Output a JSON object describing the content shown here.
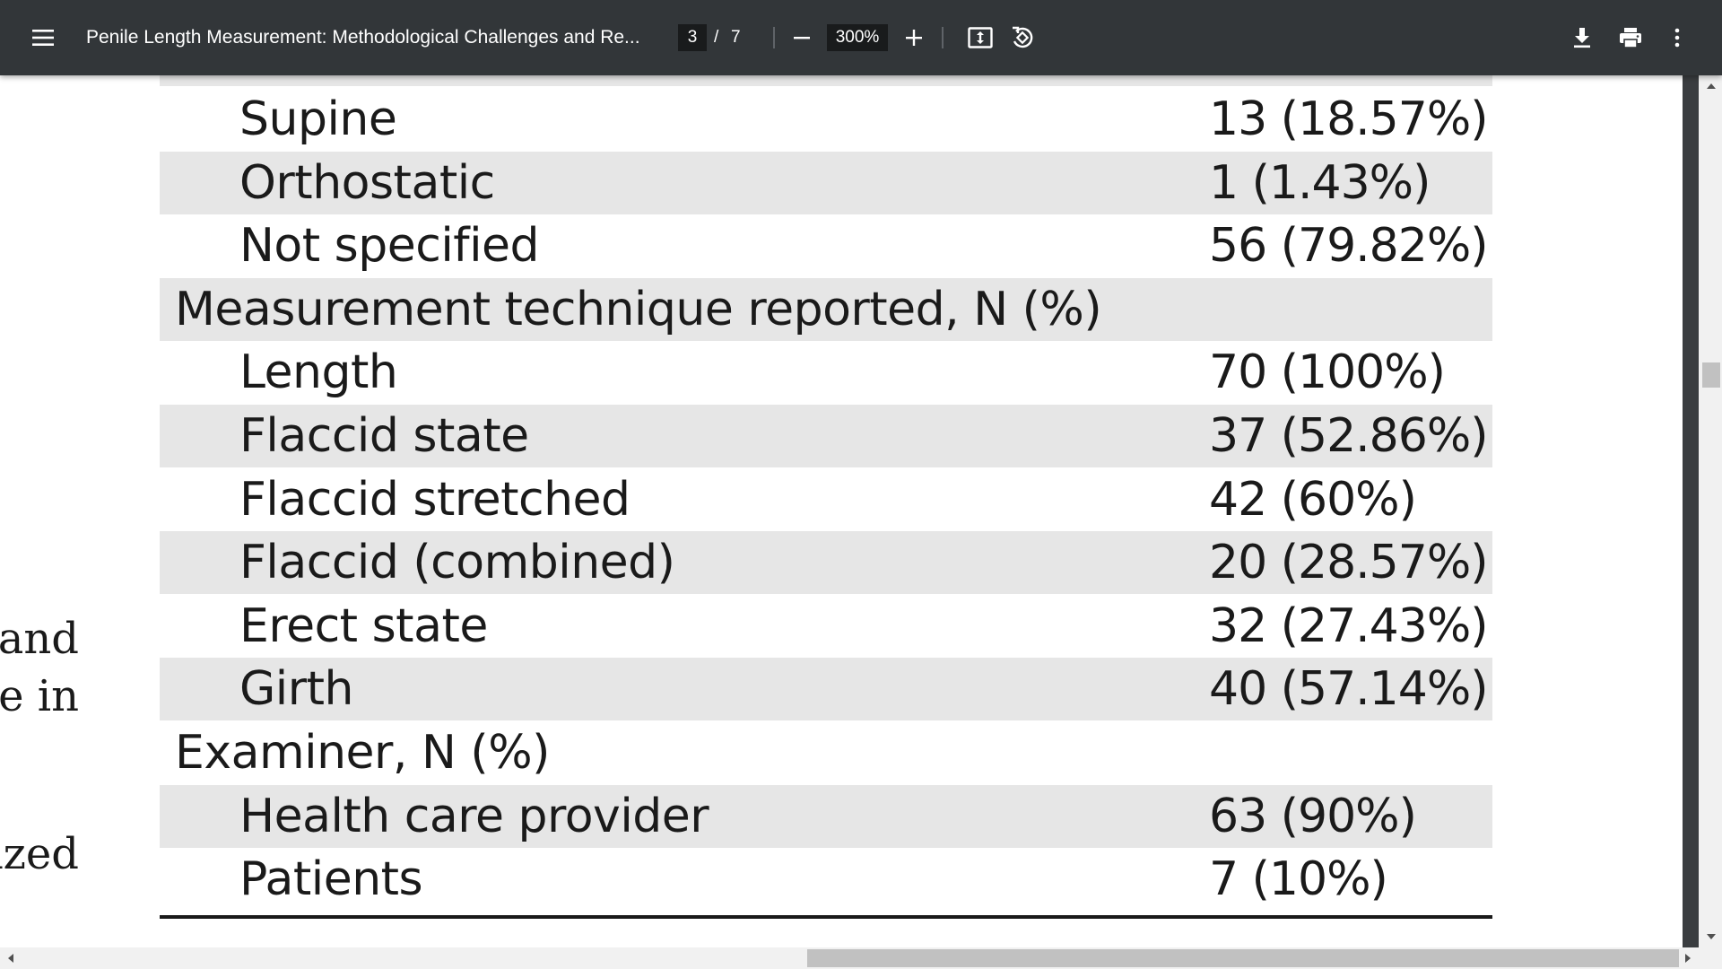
{
  "toolbar": {
    "title": "Penile Length Measurement: Methodological Challenges and Re...",
    "page_current": "3",
    "page_separator": "/",
    "page_total": "7",
    "zoom": "300%"
  },
  "side_text": [
    "and",
    "e in",
    "ized"
  ],
  "table": {
    "rows": [
      {
        "label": "Supine",
        "value": "13 (18.57%)",
        "shaded": false,
        "section": false
      },
      {
        "label": "Orthostatic",
        "value": "1 (1.43%)",
        "shaded": true,
        "section": false
      },
      {
        "label": "Not specified",
        "value": "56 (79.82%)",
        "shaded": false,
        "section": false
      },
      {
        "label": "Measurement technique reported, N (%)",
        "value": "",
        "shaded": true,
        "section": true
      },
      {
        "label": "Length",
        "value": "70 (100%)",
        "shaded": false,
        "section": false
      },
      {
        "label": "Flaccid state",
        "value": "37 (52.86%)",
        "shaded": true,
        "section": false
      },
      {
        "label": "Flaccid stretched",
        "value": "42 (60%)",
        "shaded": false,
        "section": false
      },
      {
        "label": "Flaccid (combined)",
        "value": "20 (28.57%)",
        "shaded": true,
        "section": false
      },
      {
        "label": "Erect state",
        "value": "32 (27.43%)",
        "shaded": false,
        "section": false
      },
      {
        "label": "Girth",
        "value": "40 (57.14%)",
        "shaded": true,
        "section": false
      },
      {
        "label": "Examiner, N (%)",
        "value": "",
        "shaded": false,
        "section": true
      },
      {
        "label": "Health care provider",
        "value": "63 (90%)",
        "shaded": true,
        "section": false
      },
      {
        "label": "Patients",
        "value": "7 (10%)",
        "shaded": false,
        "section": false
      }
    ]
  },
  "icons": {
    "menu": "menu-icon",
    "zoom_out": "minus-icon",
    "zoom_in": "plus-icon",
    "fit": "fit-page-icon",
    "rotate": "rotate-icon",
    "download": "download-icon",
    "print": "print-icon",
    "more": "more-vertical-icon"
  },
  "colors": {
    "toolbar_bg": "#323639",
    "row_shade": "#e6e6e6",
    "input_bg": "#191b1c"
  }
}
